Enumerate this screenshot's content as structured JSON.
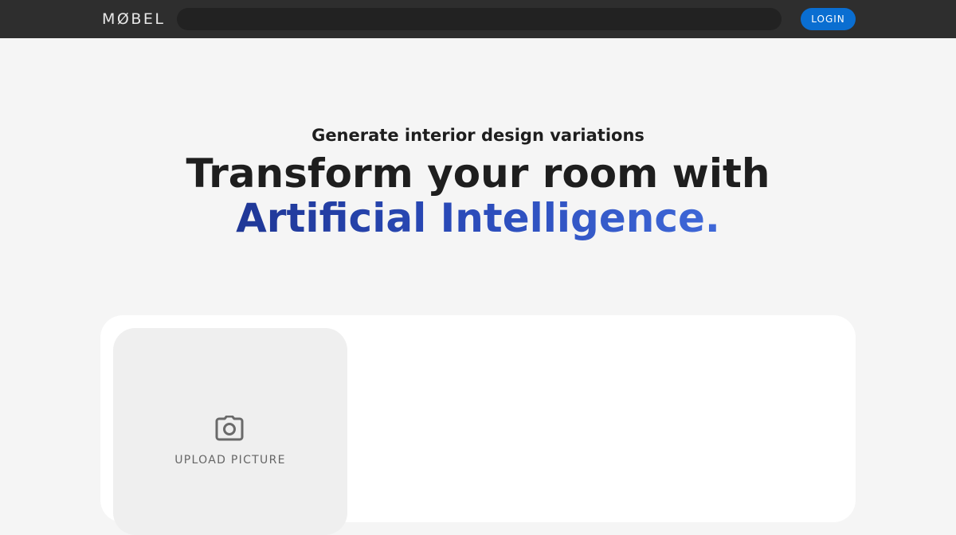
{
  "header": {
    "logo_text": "MØBEL",
    "search": {
      "value": "",
      "placeholder": ""
    },
    "login_label": "LOGIN"
  },
  "hero": {
    "subtitle": "Generate interior design variations",
    "title_line1": "Transform your room with",
    "title_line2": "Artificial Intelligence."
  },
  "upload": {
    "icon": "camera-icon",
    "label": "UPLOAD PICTURE"
  },
  "colors": {
    "topbar": "#2e2e2e",
    "login_button": "#0a6ed1",
    "accent_gradient_start": "#1f3796",
    "accent_gradient_end": "#3f68d8",
    "background": "#f5f5f5"
  }
}
